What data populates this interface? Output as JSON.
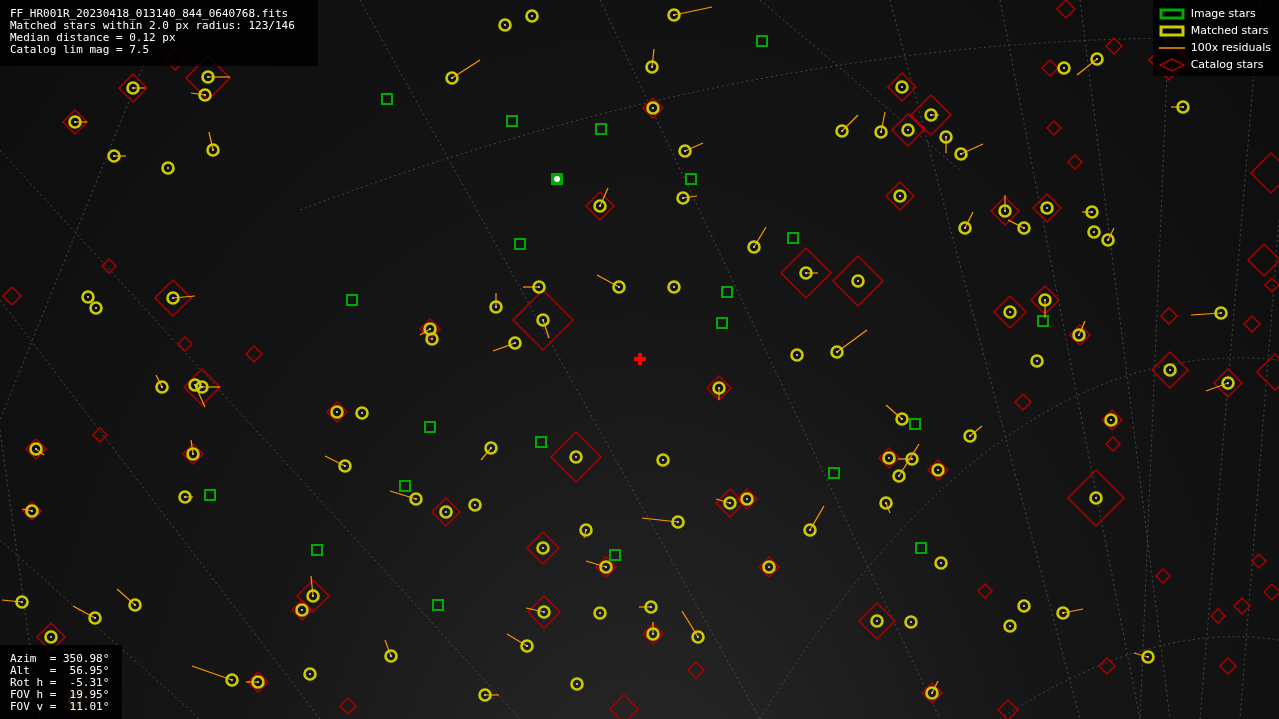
{
  "info_panel": {
    "lines": [
      "FF_HR001R_20230418_013140_844_0640768.fits",
      "Matched stars within 2.0 px radius: 123/146",
      "Median distance = 0.12 px",
      "Catalog lim mag = 7.5"
    ]
  },
  "legend": [
    {
      "kind": "image",
      "label": "Image stars"
    },
    {
      "kind": "matched",
      "label": "Matched stars"
    },
    {
      "kind": "residual",
      "label": "100x residuals"
    },
    {
      "kind": "catalog",
      "label": "Catalog stars"
    }
  ],
  "pointing_panel": {
    "lines": [
      "Azim  = 350.98°",
      "Alt   =  56.95°",
      "Rot h =  -5.31°",
      "FOV h =  19.95°",
      "FOV v =  11.01°"
    ]
  }
}
